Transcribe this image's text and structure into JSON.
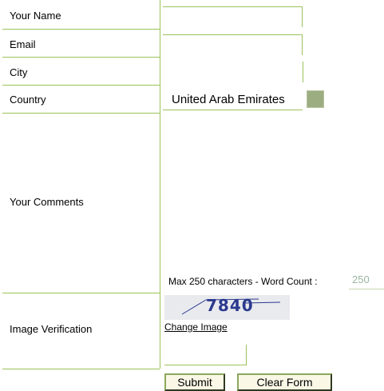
{
  "form": {
    "name_label": "Your Name",
    "name_value": "",
    "email_label": "Email",
    "email_value": "",
    "city_label": "City",
    "city_value": "",
    "country_label": "Country",
    "country_value": "United Arab Emirates",
    "comments_label": "Your Comments",
    "comments_value": "",
    "word_count_text": "Max 250 characters - Word Count :",
    "word_count_value": "250",
    "verification_label": "Image Verification",
    "captcha_text": "7840",
    "change_image_link": "Change Image",
    "verification_value": "",
    "submit_label": "Submit",
    "clear_label": "Clear Form"
  },
  "colors": {
    "border_green": "#9cc25a",
    "captcha_bg": "#e9eaee",
    "captcha_text": "#2b3a8e",
    "button_bg": "#fbf7e6"
  }
}
